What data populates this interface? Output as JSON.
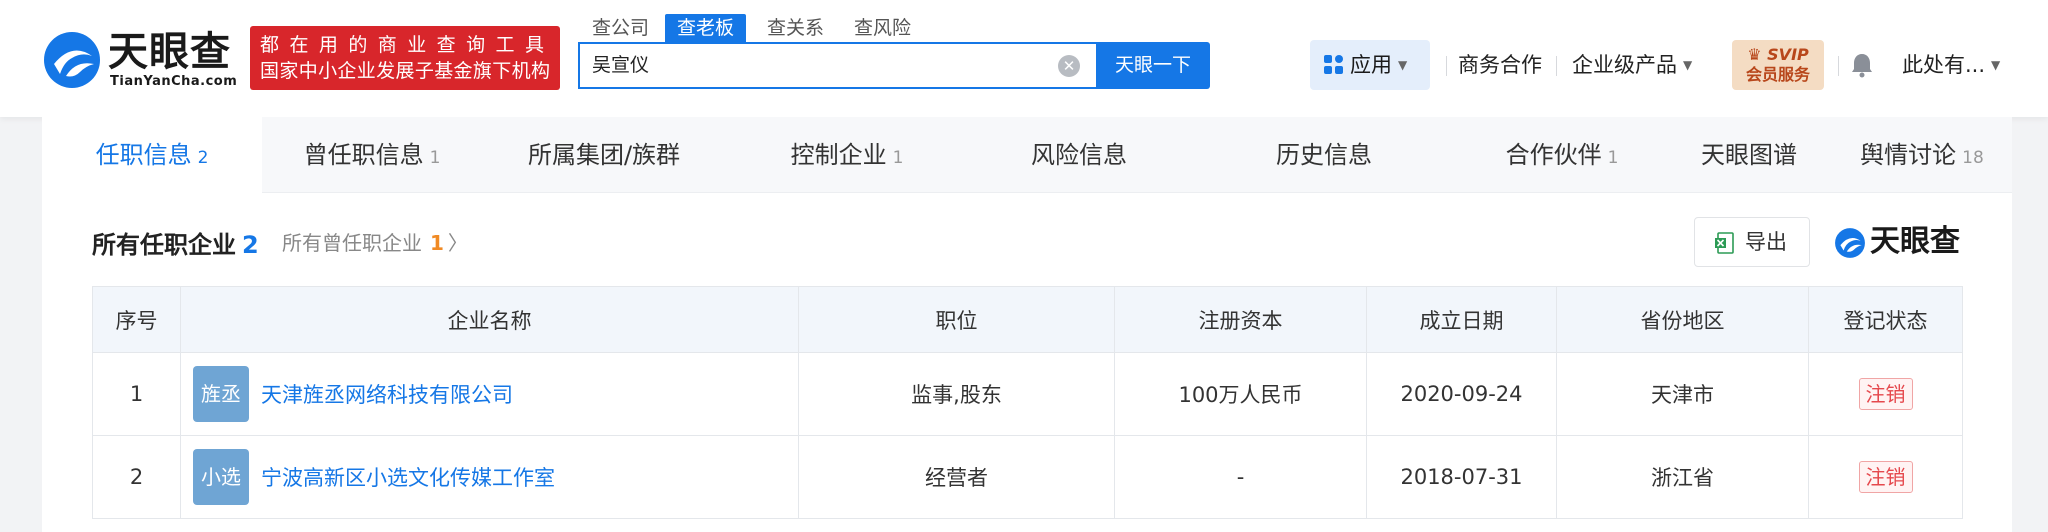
{
  "header": {
    "logo_text": "天眼查",
    "logo_domain": "TianYanCha.com",
    "slogan_line1": "都在用的商业查询工具",
    "slogan_line2": "国家中小企业发展子基金旗下机构",
    "search_tabs": [
      "查公司",
      "查老板",
      "查关系",
      "查风险"
    ],
    "active_search_tab": "查老板",
    "search_value": "吴宣仪",
    "search_button": "天眼一下",
    "app_label": "应用",
    "nav_business": "商务合作",
    "nav_enterprise": "企业级产品",
    "svip_line1": "SVIP",
    "svip_line2": "会员服务",
    "user_name": "此处有..."
  },
  "tabs": [
    {
      "label": "任职信息",
      "count": "2"
    },
    {
      "label": "曾任职信息",
      "count": "1"
    },
    {
      "label": "所属集团/族群",
      "count": ""
    },
    {
      "label": "控制企业",
      "count": "1"
    },
    {
      "label": "风险信息",
      "count": ""
    },
    {
      "label": "历史信息",
      "count": ""
    },
    {
      "label": "合作伙伴",
      "count": "1"
    },
    {
      "label": "天眼图谱",
      "count": ""
    },
    {
      "label": "舆情讨论",
      "count": "18"
    }
  ],
  "section": {
    "title": "所有任职企业",
    "title_count": "2",
    "former_label": "所有曾任职企业",
    "former_count": "1",
    "export_label": "导出",
    "watermark": "天眼查"
  },
  "table": {
    "headers": [
      "序号",
      "企业名称",
      "职位",
      "注册资本",
      "成立日期",
      "省份地区",
      "登记状态"
    ],
    "rows": [
      {
        "index": "1",
        "logo": "旌丞",
        "name": "天津旌丞网络科技有限公司",
        "position": "监事,股东",
        "capital": "100万人民币",
        "date": "2020-09-24",
        "region": "天津市",
        "status": "注销"
      },
      {
        "index": "2",
        "logo": "小选",
        "name": "宁波高新区小选文化传媒工作室",
        "position": "经营者",
        "capital": "-",
        "date": "2018-07-31",
        "region": "浙江省",
        "status": "注销"
      }
    ]
  },
  "colors": {
    "brand_blue": "#1577e6",
    "slogan_red": "#d8262b",
    "status_red": "#e5484d",
    "accent_orange": "#f08a24"
  }
}
